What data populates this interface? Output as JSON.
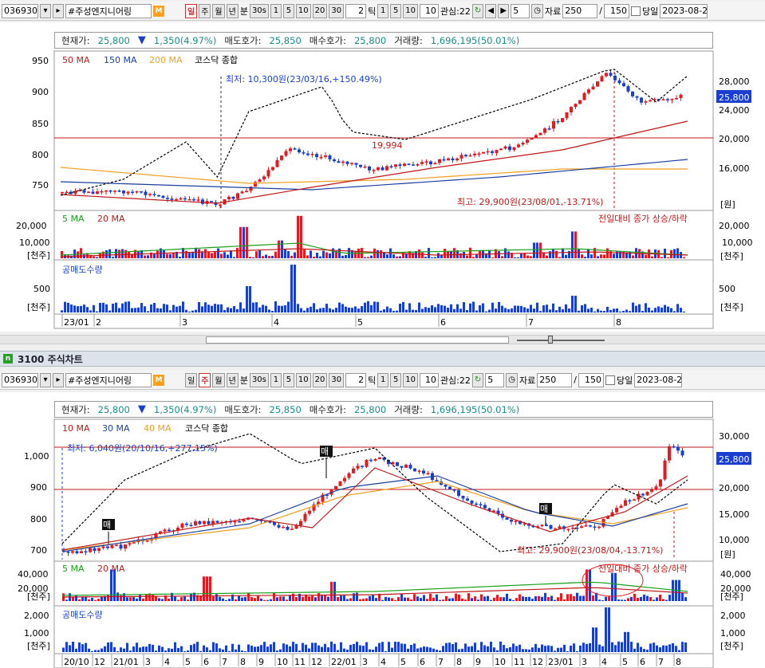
{
  "toolbar": {
    "code": "036930",
    "name": "#주성엔지니어링",
    "m_badge": "M",
    "periods": [
      "일",
      "주",
      "월",
      "년"
    ],
    "tick_unit": "분",
    "tick_options": [
      "30s",
      "1",
      "5",
      "10",
      "20",
      "30"
    ],
    "tick_count": "2",
    "tick_label": "틱",
    "tick_options2": [
      "1",
      "5",
      "10"
    ],
    "tick_count2": "10",
    "watch_label": "관심:22",
    "watch_num": "5",
    "data_label": "자료",
    "data_count": "250",
    "slash": "/",
    "max_count": "150",
    "today_label": "당일",
    "date": "2023-08-2"
  },
  "info": {
    "price_label": "현재가:",
    "price": "25,800",
    "change_arrow": "▼",
    "change": "1,350(4.97%)",
    "ask_label": "매도호가:",
    "ask": "25,850",
    "bid_label": "매수호가:",
    "bid": "25,800",
    "vol_label": "거래량:",
    "volume": "1,696,195(50.01%)"
  },
  "top_chart": {
    "legend": [
      "50 MA",
      "150 MA",
      "200 MA",
      "코스닥 종합"
    ],
    "low_note": "최저: 10,300원(23/03/16,+150.49%)",
    "high_note": "최고: 29,900원(23/08/01,-13.71%)",
    "line_label": "19,994",
    "left_axis": [
      "950",
      "900",
      "850",
      "800",
      "750"
    ],
    "right_axis": [
      "28,000",
      "24,000",
      "20,000",
      "16,000",
      "[원]"
    ],
    "price_tag": "25,800",
    "vol_legend": [
      "5 MA",
      "20 MA"
    ],
    "vol_note": "전일대비 종가 상승/하락",
    "vol_axis": [
      "20,000",
      "10,000",
      "[천주]"
    ],
    "short_legend": "공매도수량",
    "short_axis": [
      "500",
      "[천주]"
    ],
    "x_labels": [
      "23/01",
      "2",
      "3",
      "4",
      "5",
      "6",
      "7",
      "8"
    ]
  },
  "bottom_panel": {
    "title": "3100 주식차트",
    "legend": [
      "10 MA",
      "30 MA",
      "40 MA",
      "코스닥 종합"
    ],
    "low_note": "최저: 6,040원(20/10/16,+277.15%)",
    "high_note": "최고: 29,900원(23/08/04,-13.71%)",
    "left_axis": [
      "1,000",
      "900",
      "800",
      "700"
    ],
    "right_axis": [
      "30,000",
      "25,000",
      "20,000",
      "15,000",
      "10,000",
      "[원]"
    ],
    "price_tag": "25,800",
    "vol_legend": [
      "5 MA",
      "20 MA"
    ],
    "vol_note": "전일대비 종가 상승/하락",
    "vol_axis": [
      "40,000",
      "20,000",
      "[천주]"
    ],
    "short_legend": "공매도수량",
    "short_axis": [
      "2,000",
      "1,000",
      "[천주]"
    ],
    "sell_badge": "매",
    "x_labels": [
      "20/10",
      "12",
      "21/01",
      "3",
      "4",
      "5",
      "6",
      "7",
      "8",
      "9",
      "10",
      "11",
      "12",
      "22/01",
      "3",
      "4",
      "5",
      "6",
      "7",
      "8",
      "9",
      "10",
      "11",
      "12",
      "23/01",
      "3",
      "4",
      "5",
      "6",
      "7",
      "8"
    ]
  },
  "colors": {
    "up": "#e8191e",
    "down": "#1a3fd0",
    "ma50": "#c01818",
    "ma150": "#1a3fa0",
    "ma200": "#f0a020",
    "kosdaq": "#000000",
    "ma5": "#18a018"
  }
}
